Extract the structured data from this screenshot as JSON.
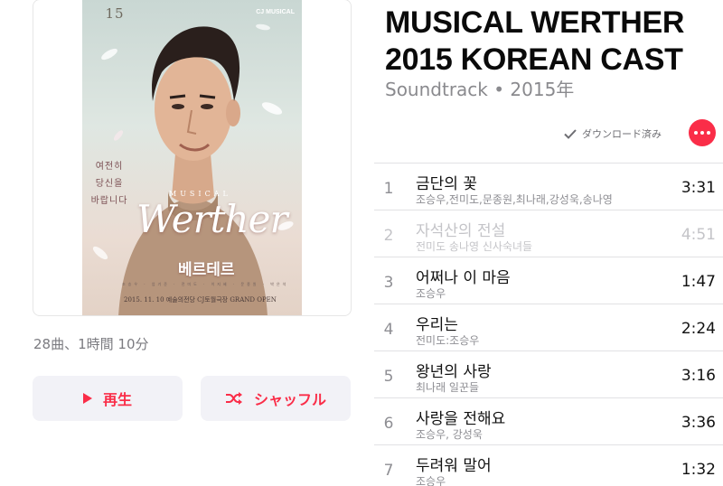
{
  "album": {
    "title_line1": "MUSICAL WERTHER",
    "title_line2": "2015 KOREAN CAST",
    "subtitle": "Soundtrack • 2015年",
    "meta": "28曲、1時間 10分"
  },
  "artwork": {
    "badge": "15",
    "brand": "CJ MUSICAL",
    "tagline_lines": [
      "여전히",
      "당신을",
      "바랍니다"
    ],
    "musical_label": "MUSICAL",
    "title_script": "Werther",
    "title_korean": "베르테르",
    "cast_line": "조승우 · 엄기준 · 전미도 · 이지혜 · 문종원 · 박은석",
    "date_line": "2015. 11. 10 예술의전당 CJ토월극장 GRAND OPEN"
  },
  "actions": {
    "play_label": "再生",
    "shuffle_label": "シャッフル",
    "downloaded_label": "ダウンロード済み"
  },
  "colors": {
    "accent": "#fa2d48",
    "button_bg": "#f2f2f7",
    "secondary_text": "#8e8e93"
  },
  "tracks": [
    {
      "num": "1",
      "title": "금단의 꽃",
      "artist": "조승우,전미도,문종원,최나래,강성욱,송나영",
      "duration": "3:31",
      "dimmed": false
    },
    {
      "num": "2",
      "title": "자석산의 전설",
      "artist": "전미도 송나영 신사숙녀들",
      "duration": "4:51",
      "dimmed": true
    },
    {
      "num": "3",
      "title": "어쩌나 이 마음",
      "artist": "조승우",
      "duration": "1:47",
      "dimmed": false
    },
    {
      "num": "4",
      "title": "우리는",
      "artist": "전미도:조승우",
      "duration": "2:24",
      "dimmed": false
    },
    {
      "num": "5",
      "title": "왕년의 사랑",
      "artist": "최나래 일꾼들",
      "duration": "3:16",
      "dimmed": false
    },
    {
      "num": "6",
      "title": "사랑을 전해요",
      "artist": "조승우, 강성욱",
      "duration": "3:36",
      "dimmed": false
    },
    {
      "num": "7",
      "title": "두려워 말어",
      "artist": "조승우",
      "duration": "1:32",
      "dimmed": false
    }
  ]
}
